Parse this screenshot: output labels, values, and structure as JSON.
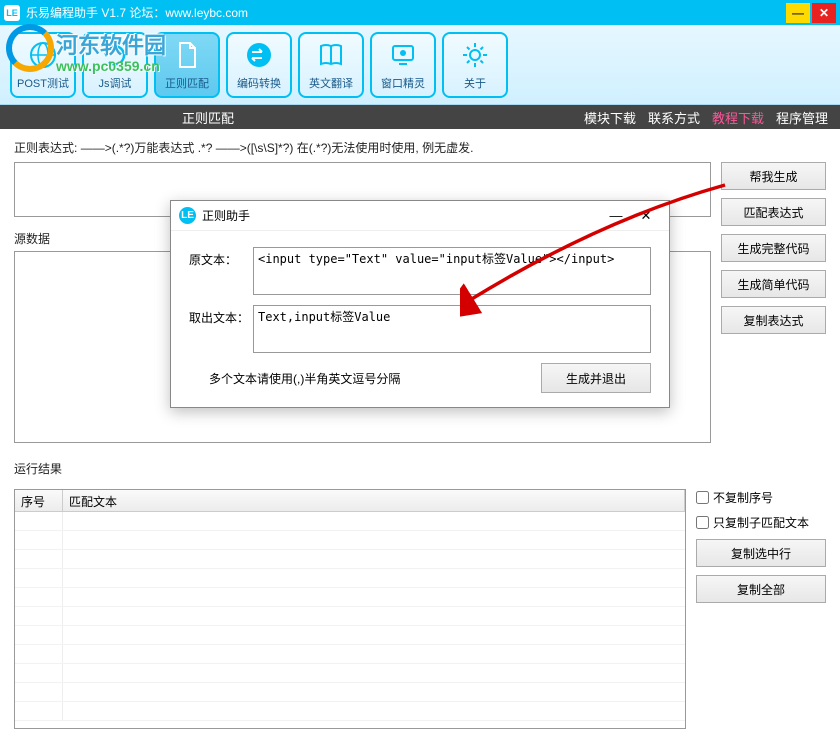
{
  "window": {
    "app_icon": "LE",
    "title": "乐易编程助手  V1.7 论坛：www.leybc.com"
  },
  "watermark": {
    "text": "河东软件园",
    "url": "www.pc0359.cn"
  },
  "toolbar": [
    {
      "id": "post-test",
      "label": "POST测试"
    },
    {
      "id": "js-debug",
      "label": "Js调试"
    },
    {
      "id": "regex-match",
      "label": "正则匹配"
    },
    {
      "id": "encode-convert",
      "label": "编码转换"
    },
    {
      "id": "english-translate",
      "label": "英文翻译"
    },
    {
      "id": "window-spy",
      "label": "窗口精灵"
    },
    {
      "id": "about",
      "label": "关于"
    }
  ],
  "menubar": {
    "left": "正则匹配",
    "links": [
      {
        "label": "模块下载",
        "highlight": false
      },
      {
        "label": "联系方式",
        "highlight": false
      },
      {
        "label": "教程下载",
        "highlight": true
      },
      {
        "label": "程序管理",
        "highlight": false
      }
    ]
  },
  "labels": {
    "regex_expr": "正则表达式:",
    "regex_hint": "——>(.*?)万能表达式  .*? ——>([\\s\\S]*?)     在(.*?)无法使用时使用, 例无虚发.",
    "source_data": "源数据",
    "run_result": "运行结果",
    "col_index": "序号",
    "col_matched": "匹配文本"
  },
  "side_buttons": {
    "gen_for_me": "帮我生成",
    "match_expr": "匹配表达式",
    "gen_full_code": "生成完整代码",
    "gen_simple_code": "生成简单代码",
    "copy_expr": "复制表达式"
  },
  "result_side": {
    "no_copy_index": "不复制序号",
    "only_copy_sub": "只复制子匹配文本",
    "copy_selected": "复制选中行",
    "copy_all": "复制全部"
  },
  "dialog": {
    "icon": "LE",
    "title": "正则助手",
    "label_source": "原文本：",
    "label_extract": "取出文本：",
    "value_source": "<input type=\"Text\" value=\"input标签Value\"></input>",
    "value_extract": "Text,input标签Value",
    "hint": "多个文本请使用(,)半角英文逗号分隔",
    "btn_generate": "生成并退出"
  }
}
